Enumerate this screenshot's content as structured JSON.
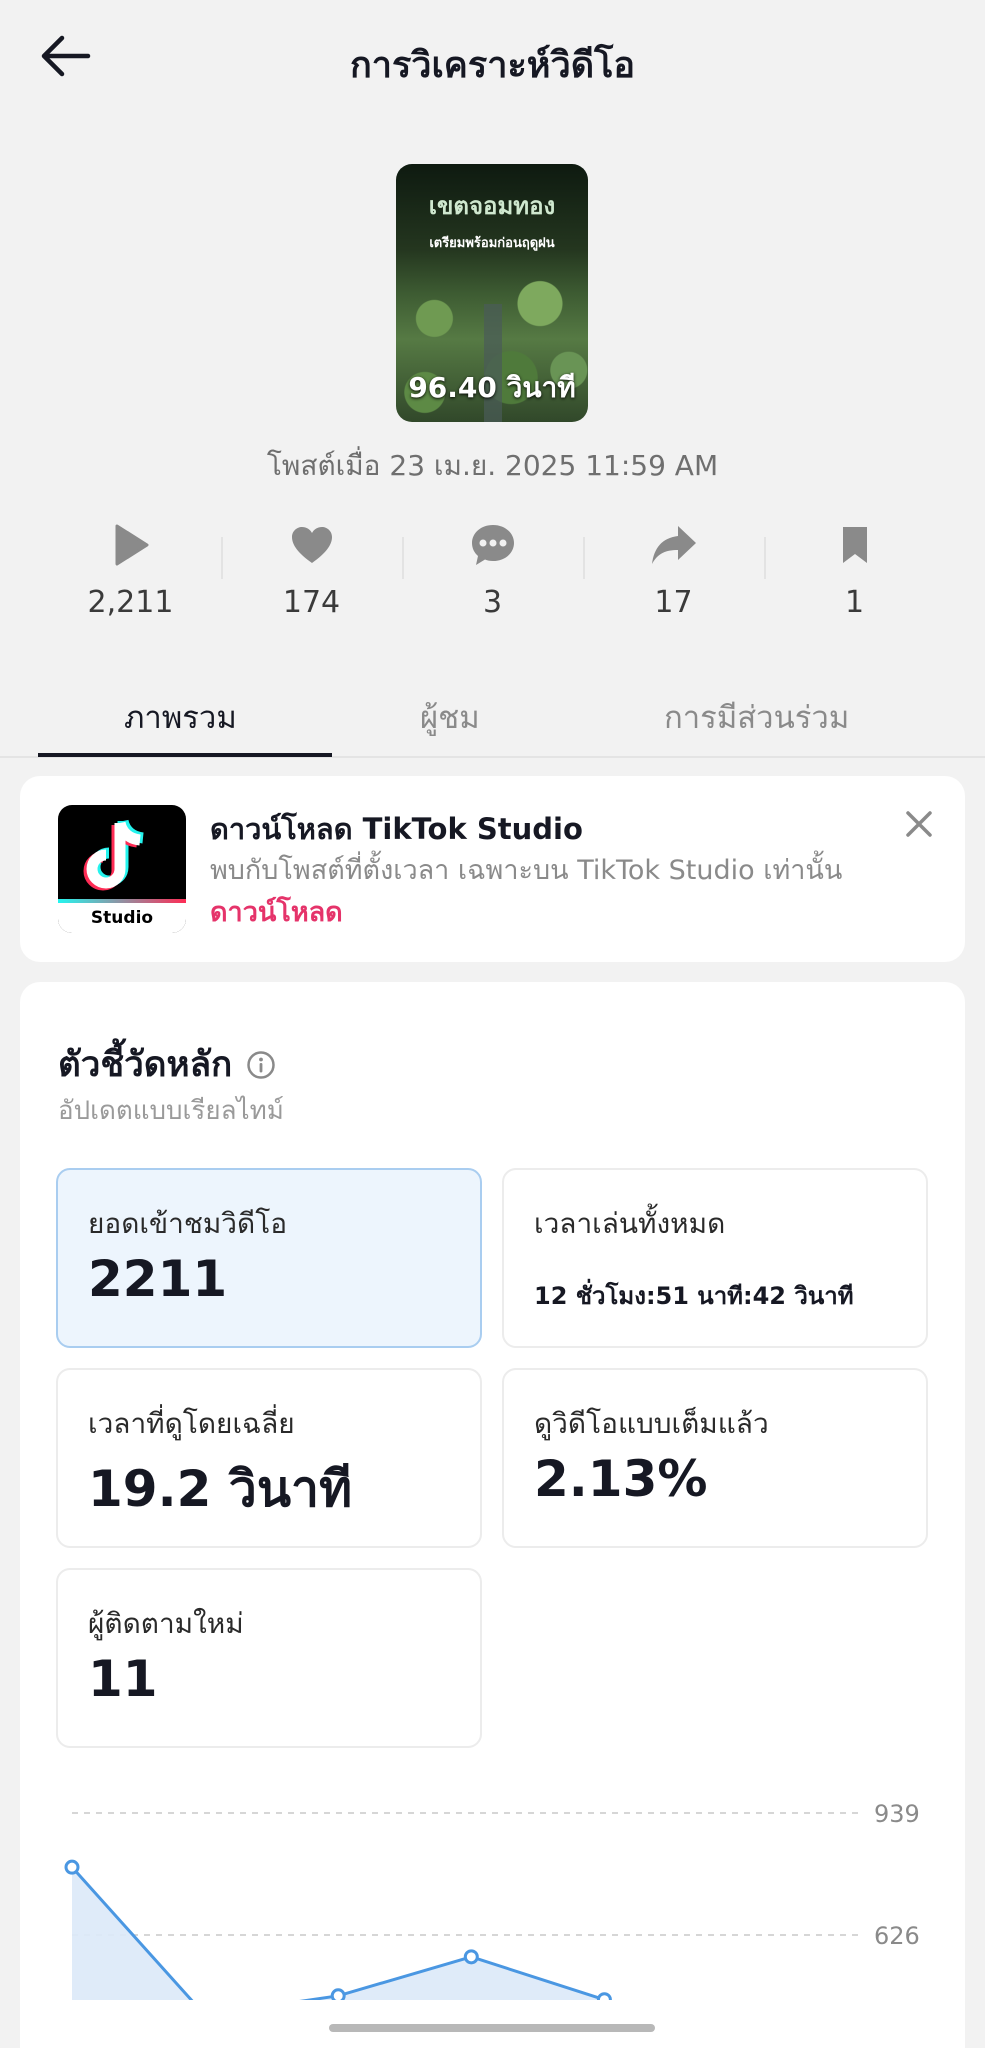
{
  "header": {
    "title": "การวิเคราะห์วิดีโอ",
    "back_icon": "arrow-left-icon"
  },
  "video": {
    "thumb_title": "เขตจอมทอง",
    "thumb_subtitle": "เตรียมพร้อมก่อนฤดูฝน",
    "duration": "96.40 วินาที",
    "posted_at": "โพสต์เมื่อ 23 เม.ย. 2025 11:59 AM"
  },
  "stats": [
    {
      "icon": "play-icon",
      "value": "2,211"
    },
    {
      "icon": "heart-icon",
      "value": "174"
    },
    {
      "icon": "comment-icon",
      "value": "3"
    },
    {
      "icon": "share-icon",
      "value": "17"
    },
    {
      "icon": "bookmark-icon",
      "value": "1"
    }
  ],
  "tabs": [
    {
      "label": "ภาพรวม",
      "active": true
    },
    {
      "label": "ผู้ชม",
      "active": false
    },
    {
      "label": "การมีส่วนร่วม",
      "active": false
    }
  ],
  "promo": {
    "title": "ดาวน์โหลด TikTok Studio",
    "description": "พบกับโพสต์ที่ตั้งเวลา เฉพาะบน TikTok Studio เท่านั้น",
    "link": "ดาวน์โหลด",
    "app_label": "Studio"
  },
  "metrics": {
    "title": "ตัวชี้วัดหลัก",
    "subtitle": "อัปเดตแบบเรียลไทม์",
    "items": [
      {
        "label": "ยอดเข้าชมวิดีโอ",
        "value": "2211",
        "selected": true
      },
      {
        "label": "เวลาเล่นทั้งหมด",
        "value": "12 ชั่วโมง:51 นาที:42 วินาที"
      },
      {
        "label": "เวลาที่ดูโดยเฉลี่ย",
        "value": "19.2 วินาที"
      },
      {
        "label": "ดูวิดีโอแบบเต็มแล้ว",
        "value": "2.13%"
      },
      {
        "label": "ผู้ติดตามใหม่",
        "value": "11"
      }
    ]
  },
  "chart_data": {
    "type": "area",
    "x": [
      0,
      1,
      2,
      3,
      4
    ],
    "values": [
      800,
      420,
      470,
      570,
      460
    ],
    "ytick_labels": [
      "939",
      "626"
    ],
    "yticks": [
      939,
      626
    ],
    "ylim": [
      313,
      939
    ],
    "colors": {
      "line": "#4a97e2",
      "fill": "#dbe9f8"
    }
  }
}
